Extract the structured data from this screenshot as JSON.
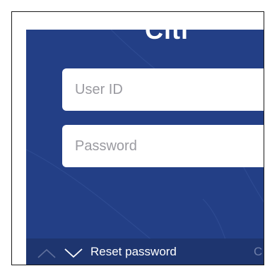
{
  "app": {
    "logo_text": "Citi"
  },
  "login": {
    "user_id_placeholder": "User ID",
    "password_placeholder": "Password"
  },
  "accessory_bar": {
    "prev_icon": "chevron-up-icon",
    "next_icon": "chevron-down-icon",
    "reset_label": "Reset password",
    "right_partial_label": "C"
  },
  "colors": {
    "background": "#233f86",
    "accessory_bar": "#1e356f",
    "field_background": "#ffffff",
    "placeholder": "#9a9aa0"
  }
}
